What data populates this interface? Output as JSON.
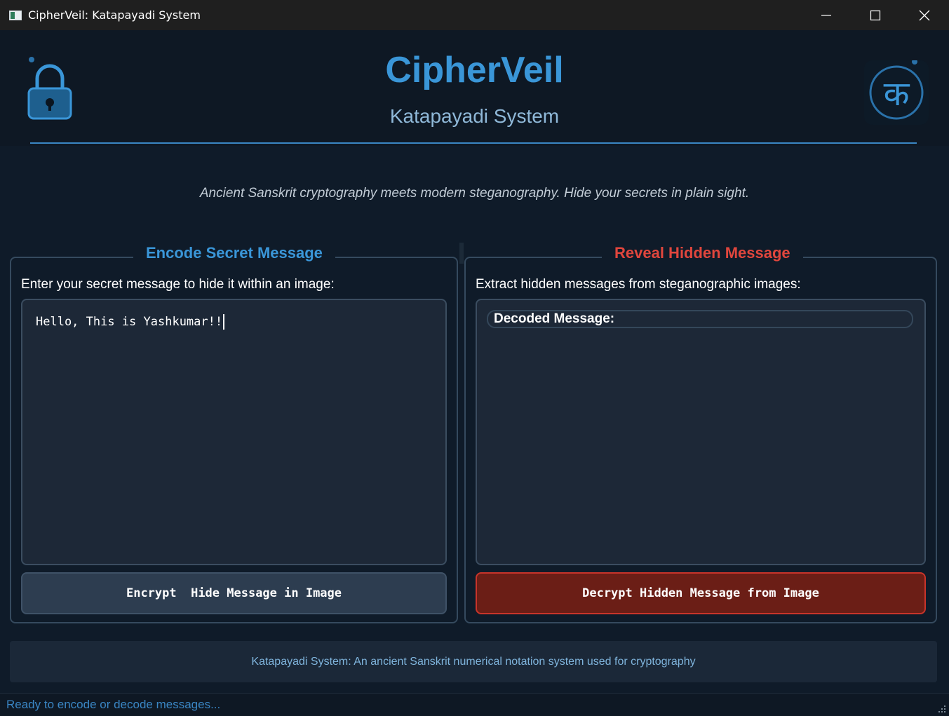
{
  "window": {
    "title": "CipherVeil: Katapayadi System",
    "controls": [
      "minimize-icon",
      "maximize-icon",
      "close-icon"
    ]
  },
  "header": {
    "title": "CipherVeil",
    "subtitle": "Katapayadi System",
    "left_icon": "lock-icon",
    "right_icon": "ka-glyph-icon",
    "right_glyph": "क"
  },
  "tagline": "Ancient Sanskrit cryptography meets modern steganography. Hide your secrets in plain sight.",
  "encode": {
    "legend": "Encode Secret Message",
    "description": "Enter your secret message to hide it within an image:",
    "message_value": "Hello, This is Yashkumar!!",
    "button_label": "Encrypt  Hide Message in Image"
  },
  "decode": {
    "legend": "Reveal Hidden Message",
    "description": "Extract hidden messages from steganographic images:",
    "decoded_label": "Decoded Message:",
    "button_label": "Decrypt Hidden Message from Image"
  },
  "info": "Katapayadi System: An ancient Sanskrit numerical notation system used for cryptography",
  "status": "Ready to encode or decode messages...",
  "colors": {
    "background": "#0f1b29",
    "accent_blue": "#3a96d8",
    "accent_red": "#e0463d",
    "decrypt_button": "#6b1e16",
    "encrypt_button": "#2d3d50"
  }
}
